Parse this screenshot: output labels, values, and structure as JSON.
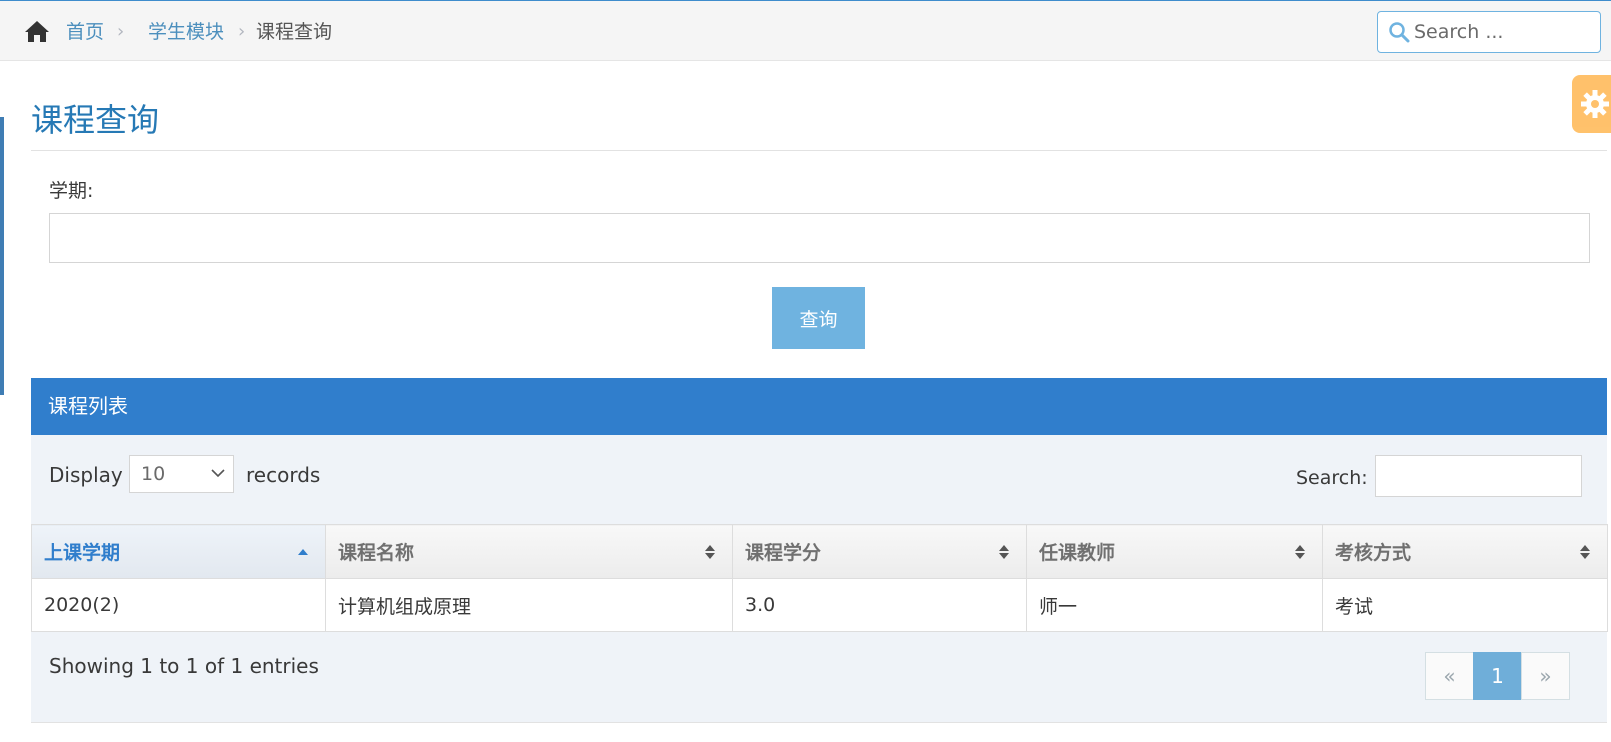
{
  "breadcrumb": {
    "home": "首页",
    "module": "学生模块",
    "current": "课程查询",
    "separator": "›"
  },
  "nav_search": {
    "placeholder": "Search ..."
  },
  "page": {
    "title": "课程查询"
  },
  "form": {
    "term_label": "学期:",
    "term_value": "",
    "query_button": "查询"
  },
  "panel": {
    "title": "课程列表",
    "display_label": "Display",
    "display_value": "10",
    "records_label": "records",
    "search_label": "Search:",
    "search_value": ""
  },
  "table": {
    "headers": [
      "上课学期",
      "课程名称",
      "课程学分",
      "任课教师",
      "考核方式"
    ],
    "sorted_column": 0,
    "rows": [
      [
        "2020(2)",
        "计算机组成原理",
        "3.0",
        "师一",
        "考试"
      ]
    ]
  },
  "footer": {
    "showing": "Showing 1 to 1 of 1 entries",
    "prev": "«",
    "page": "1",
    "next": "»"
  },
  "colors": {
    "accent": "#307ecc",
    "link": "#4c8fbd",
    "button": "#6fb3e0",
    "settings": "#ffb752"
  },
  "icons": [
    "home-icon",
    "search-icon",
    "gear-icon",
    "chevron-down-icon",
    "sort-asc-icon",
    "sort-both-icon"
  ]
}
